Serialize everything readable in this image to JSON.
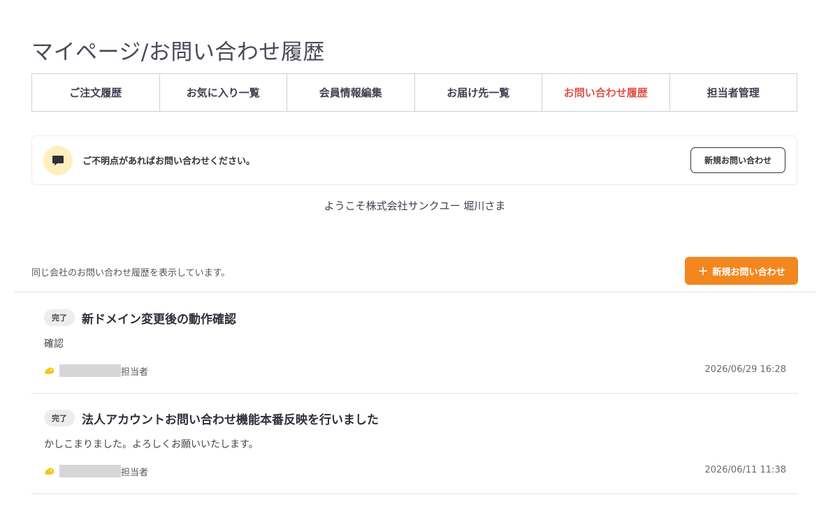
{
  "page": {
    "title": "マイページ/お問い合わせ履歴"
  },
  "tabs": [
    {
      "label": "ご注文履歴",
      "active": false
    },
    {
      "label": "お気に入り一覧",
      "active": false
    },
    {
      "label": "会員情報編集",
      "active": false
    },
    {
      "label": "お届け先一覧",
      "active": false
    },
    {
      "label": "お問い合わせ履歴",
      "active": true
    },
    {
      "label": "担当者管理",
      "active": false
    }
  ],
  "notice": {
    "icon": "chat-bubble-icon",
    "text": "ご不明点があればお問い合わせください。",
    "button_label": "新規お問い合わせ"
  },
  "welcome": "ようこそ株式会社サンクユー 堀川さま",
  "list_header": {
    "note": "同じ会社のお問い合わせ履歴を表示しています。",
    "new_button_icon": "+",
    "new_button_label": "新規お問い合わせ"
  },
  "inquiries": [
    {
      "status": "完了",
      "title": "新ドメイン変更後の動作確認",
      "body": "確認",
      "staff_label": "担当者",
      "date": "2026/06/29 16:28"
    },
    {
      "status": "完了",
      "title": "法人アカウントお問い合わせ機能本番反映を行いました",
      "body": "かしこまりました。よろしくお願いいたします。",
      "staff_label": "担当者",
      "date": "2026/06/11 11:38"
    }
  ],
  "colors": {
    "accent_orange": "#f3871f",
    "active_tab_red": "#e0524a",
    "notice_icon_bg": "#fdf0bd",
    "staff_icon_yellow": "#f5c518"
  }
}
